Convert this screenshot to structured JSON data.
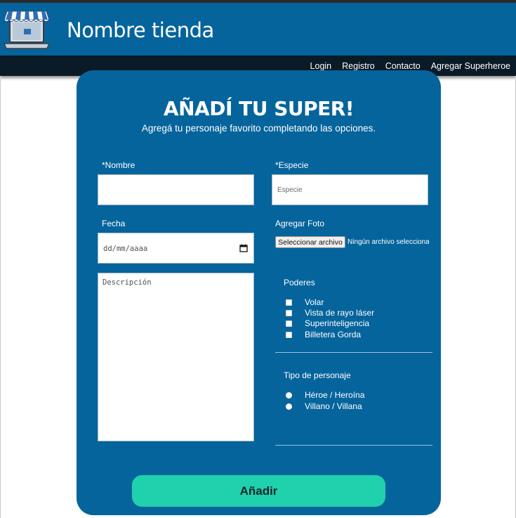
{
  "header": {
    "store_name": "Nombre tienda"
  },
  "nav": {
    "items": [
      "Login",
      "Registro",
      "Contacto",
      "Agregar Superheroe"
    ]
  },
  "form": {
    "title": "AÑADÍ TU SUPER!",
    "subtitle": "Agregá tu personaje favorito completando las opciones.",
    "nombre_label": "*Nombre",
    "nombre_value": "",
    "especie_label": "*Especie",
    "especie_placeholder": "Especie",
    "fecha_label": "Fecha",
    "fecha_placeholder": "dd/mm/aaaa",
    "foto_label": "Agregar Foto",
    "file_button_label": "Seleccionar archivo",
    "file_status": "Ningún archivo seleccionado",
    "descripcion_placeholder": "Descripción",
    "poderes_label": "Poderes",
    "poderes": [
      "Volar",
      "Vista de rayo láser",
      "Superinteligencia",
      "Billetera Gorda"
    ],
    "tipo_label": "Tipo de personaje",
    "tipos": [
      "Héroe / Heroína",
      "Villano / Villana"
    ],
    "submit_label": "Añadir"
  },
  "colors": {
    "header_bg": "#05649c",
    "navbar_bg": "#0b1a27",
    "card_bg": "#05649c",
    "submit_bg": "#1fd1ad"
  },
  "icons": {
    "logo": "storefront-laptop-icon",
    "calendar": "calendar-icon"
  }
}
